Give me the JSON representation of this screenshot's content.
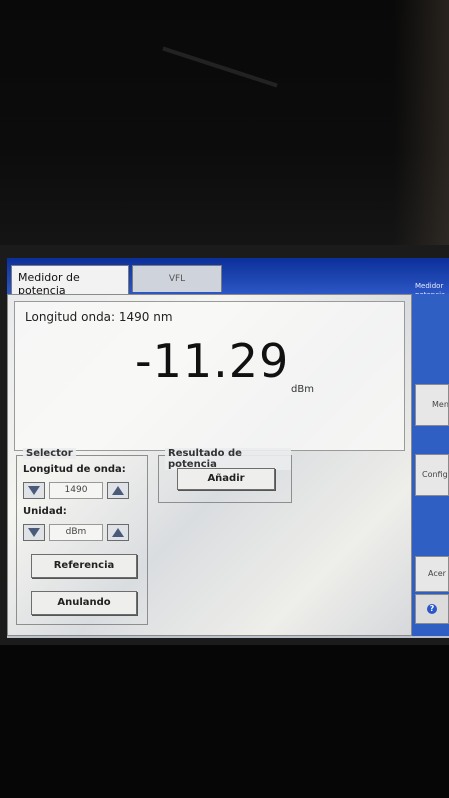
{
  "tabs": [
    {
      "label": "Medidor de potencia"
    },
    {
      "label": "VFL"
    }
  ],
  "display": {
    "wavelength_label": "Longitud onda: 1490 nm",
    "power_value": "-11.29",
    "power_unit": "dBm"
  },
  "selector": {
    "title": "Selector",
    "wavelength_label": "Longitud de onda:",
    "wavelength_value": "1490",
    "unit_label": "Unidad:",
    "unit_value": "dBm",
    "reference_button": "Referencia",
    "cancel_button": "Anulando"
  },
  "result": {
    "title": "Resultado de potencia",
    "add_button": "Añadir"
  },
  "side_panel": {
    "header": "Medidor potencia",
    "buttons": [
      {
        "label": "Men"
      },
      {
        "label": "Config"
      },
      {
        "label": "Acer"
      }
    ],
    "help_icon": "question-mark-icon"
  }
}
